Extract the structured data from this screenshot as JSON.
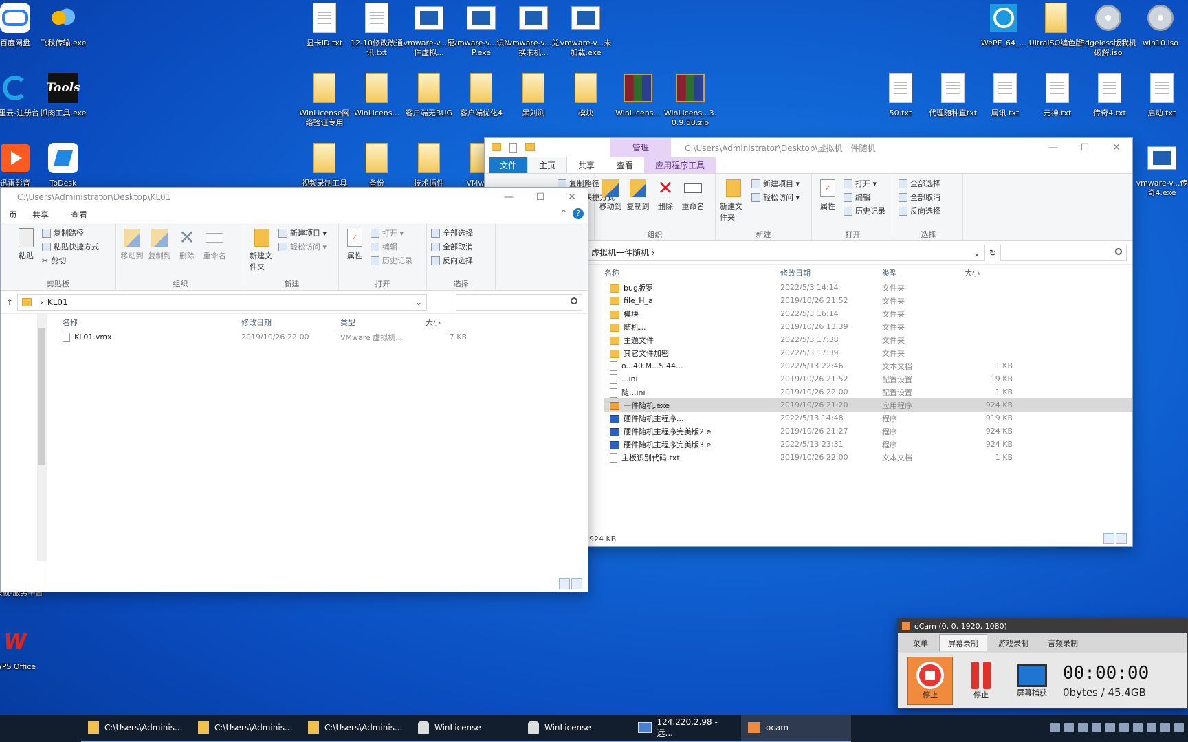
{
  "desktop": {
    "icons": [
      {
        "label": "百度网盘",
        "kind": "cloud"
      },
      {
        "label": "飞秋传输.exe",
        "kind": "bird"
      },
      {
        "label": "显卡ID.txt",
        "kind": "doc"
      },
      {
        "label": "12-10修改改通讯.txt",
        "kind": "doc"
      },
      {
        "label": "vmware-v...硬件虚拟...",
        "kind": "vm"
      },
      {
        "label": "vmware-v...识NP.exe",
        "kind": "vm"
      },
      {
        "label": "vmware-v...兑换末机...",
        "kind": "vm"
      },
      {
        "label": "vmware-v...未加载.exe",
        "kind": "vm"
      },
      {
        "label": "WePE_64_...",
        "kind": "wepe"
      },
      {
        "label": "UltraISO编色版",
        "kind": "tallfolder"
      },
      {
        "label": "Edgeless版我机破解.iso",
        "kind": "iso"
      },
      {
        "label": "win10.iso",
        "kind": "iso"
      },
      {
        "label": "阿里云-注册台",
        "kind": "edge"
      },
      {
        "label": "抓肉工具.exe",
        "kind": "tools"
      },
      {
        "label": "WinLicense网络验证专用",
        "kind": "tallfolder"
      },
      {
        "label": "WinLicens...",
        "kind": "tallfolder"
      },
      {
        "label": "客户端无BUG",
        "kind": "tallfolder"
      },
      {
        "label": "客户端优化4",
        "kind": "tallfolder"
      },
      {
        "label": "黑刘测",
        "kind": "tallfolder"
      },
      {
        "label": "模块",
        "kind": "tallfolder"
      },
      {
        "label": "WinLicens...",
        "kind": "rar"
      },
      {
        "label": "WinLicens...3.0.9.50.zip",
        "kind": "rar"
      },
      {
        "label": "50.txt",
        "kind": "doc"
      },
      {
        "label": "代理随种直txt",
        "kind": "doc"
      },
      {
        "label": "属讯.txt",
        "kind": "doc"
      },
      {
        "label": "元神.txt",
        "kind": "doc"
      },
      {
        "label": "传奇4.txt",
        "kind": "doc"
      },
      {
        "label": "启动.txt",
        "kind": "doc"
      },
      {
        "label": "迅雷影音",
        "kind": "play"
      },
      {
        "label": "ToDesk",
        "kind": "todesk"
      },
      {
        "label": "视频录制工具",
        "kind": "tallfolder"
      },
      {
        "label": "备份",
        "kind": "tallfolder"
      },
      {
        "label": "技术插件",
        "kind": "tallfolder"
      },
      {
        "label": "VMwa...",
        "kind": "tallfolder"
      },
      {
        "label": "vmware-v...传奇4.exe",
        "kind": "vm"
      },
      {
        "label": "户模板-服务平台",
        "kind": "none"
      },
      {
        "label": "WPS Office",
        "kind": "wps"
      }
    ]
  },
  "win1": {
    "title": "C:\\Users\\Administrator\\Desktop\\KL01",
    "tabs": [
      "页",
      "共享",
      "查看"
    ],
    "ribbon": {
      "clipboard": {
        "paste": "粘贴",
        "copy_path": "复制路径",
        "paste_shortcut": "粘贴快捷方式",
        "cut": "剪切",
        "name": "剪贴板"
      },
      "organize": {
        "move": "移动到",
        "copy": "复制到",
        "delete": "删除",
        "rename": "重命名",
        "name": "组织"
      },
      "new": {
        "new_folder": "新建文件夹",
        "new_item": "新建项目 ▾",
        "easy_access": "轻松访问 ▾",
        "name": "新建"
      },
      "open": {
        "props": "属性",
        "open": "打开 ▾",
        "edit": "编辑",
        "history": "历史记录",
        "name": "打开"
      },
      "select": {
        "all": "全部选择",
        "none": "全部取消",
        "invert": "反向选择",
        "name": "选择"
      }
    },
    "address": "KL01",
    "columns": [
      "名称",
      "修改日期",
      "类型",
      "大小"
    ],
    "files": [
      {
        "name": "KL01.vmx",
        "date": "2019/10/26 22:00",
        "type": "VMware 虚拟机...",
        "size": "7 KB"
      }
    ]
  },
  "win2": {
    "title": "C:\\Users\\Administrator\\Desktop\\虚拟机一件随机",
    "manage": "管理",
    "tabs": [
      "文件",
      "主页",
      "共享",
      "查看",
      "应用程序工具"
    ],
    "ribbon": {
      "clipboard": {
        "copy_path": "复制路径",
        "paste_shortcut": "粘贴快捷方式"
      },
      "organize": {
        "move": "移动到",
        "copy": "复制到",
        "delete": "删除",
        "rename": "重命名",
        "name": "组织"
      },
      "new": {
        "new_folder": "新建文件夹",
        "new_item": "新建项目 ▾",
        "easy_access": "轻松访问 ▾",
        "name": "新建"
      },
      "open": {
        "props": "属性",
        "open": "打开 ▾",
        "edit": "编辑",
        "history": "历史记录",
        "name": "打开"
      },
      "select": {
        "all": "全部选择",
        "none": "全部取消",
        "invert": "反向选择",
        "name": "选择"
      }
    },
    "address": "虚拟机一件随机 ›",
    "columns": [
      "名称",
      "修改日期",
      "类型",
      "大小"
    ],
    "files": [
      {
        "name": "bug版罗",
        "date": "2022/5/3 14:14",
        "type": "文件夹",
        "size": "",
        "icon": "folder"
      },
      {
        "name": "file_H_a",
        "date": "2019/10/26 21:52",
        "type": "文件夹",
        "size": "",
        "icon": "folder"
      },
      {
        "name": "模块",
        "date": "2022/5/3 16:14",
        "type": "文件夹",
        "size": "",
        "icon": "folder"
      },
      {
        "name": "随机...",
        "date": "2019/10/26 13:39",
        "type": "文件夹",
        "size": "",
        "icon": "folder"
      },
      {
        "name": "主题文件",
        "date": "2022/5/3 17:38",
        "type": "文件夹",
        "size": "",
        "icon": "folder"
      },
      {
        "name": "其它文件加密",
        "date": "2022/5/3 17:39",
        "type": "文件夹",
        "size": "",
        "icon": "folder"
      },
      {
        "name": "o...40.M...S.44...",
        "date": "2022/5/13 22:46",
        "type": "文本文档",
        "size": "1 KB",
        "icon": "txt"
      },
      {
        "name": "...ini",
        "date": "2019/10/26 21:52",
        "type": "配置设置",
        "size": "19 KB",
        "icon": "txt"
      },
      {
        "name": "随...ini",
        "date": "2019/10/26 22:00",
        "type": "配置设置",
        "size": "1 KB",
        "icon": "txt"
      },
      {
        "name": "一件随机.exe",
        "date": "2019/10/26 21:20",
        "type": "应用程序",
        "size": "924 KB",
        "icon": "app",
        "selected": true
      },
      {
        "name": "硬件随机主程序...",
        "date": "2022/5/13 14:48",
        "type": "程序",
        "size": "919 KB",
        "icon": "exe"
      },
      {
        "name": "硬件随机主程序完美版2.e",
        "date": "2019/10/26 21:27",
        "type": "程序",
        "size": "924 KB",
        "icon": "exe"
      },
      {
        "name": "硬件随机主程序完美版3.e",
        "date": "2022/5/13 23:31",
        "type": "程序",
        "size": "924 KB",
        "icon": "exe"
      },
      {
        "name": "主板识别代码.txt",
        "date": "2019/10/26 22:00",
        "type": "文本文档",
        "size": "1 KB",
        "icon": "txt"
      }
    ],
    "status": "924 KB"
  },
  "ocam": {
    "title": "oCam (0, 0, 1920, 1080)",
    "tabs": [
      "菜单",
      "屏幕录制",
      "游戏录制",
      "音频录制"
    ],
    "stop": "停止",
    "pause": "停止",
    "capture": "屏幕捕获",
    "time": "00:00:00",
    "size": "0bytes / 45.4GB"
  },
  "taskbar": {
    "items": [
      {
        "label": "C:\\Users\\Adminis...",
        "icon": "folder"
      },
      {
        "label": "C:\\Users\\Adminis...",
        "icon": "folder"
      },
      {
        "label": "C:\\Users\\Adminis...",
        "icon": "folder"
      },
      {
        "label": "WinLicense",
        "icon": "lock"
      },
      {
        "label": "WinLicense",
        "icon": "lock"
      },
      {
        "label": "124.220.2.98 - 远...",
        "icon": "rdp"
      },
      {
        "label": "ocam",
        "icon": "ocam"
      }
    ]
  }
}
